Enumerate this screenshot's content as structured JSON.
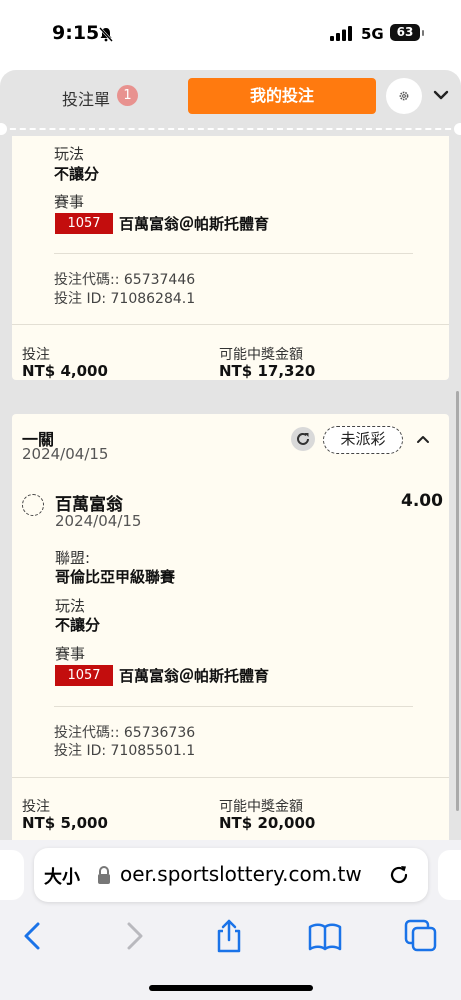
{
  "status_bar": {
    "time": "9:15",
    "network": "5G",
    "battery": "63"
  },
  "header": {
    "slip_tab": "投注單",
    "slip_count": "1",
    "my_bets_tab": "我的投注"
  },
  "bet_top": {
    "play_label": "玩法",
    "play_value": "不讓分",
    "event_label": "賽事",
    "event_number": "1057",
    "event_name": "百萬富翁＠帕斯托體育",
    "code_line": "投注代碼:: 65737446",
    "id_line": "投注 ID: 71086284.1",
    "stake_label": "投注",
    "stake_value": "NT$ 4,000",
    "payout_label": "可能中獎金額",
    "payout_value": "NT$ 17,320"
  },
  "bet_second": {
    "type": "一關",
    "date": "2024/04/15",
    "status": "未派彩",
    "selection": "百萬富翁",
    "selection_date": "2024/04/15",
    "odds": "4.00",
    "league_label": "聯盟:",
    "league_value": "哥倫比亞甲級聯賽",
    "play_label": "玩法",
    "play_value": "不讓分",
    "event_label": "賽事",
    "event_number": "1057",
    "event_name": "百萬富翁＠帕斯托體育",
    "code_line": "投注代碼:: 65736736",
    "id_line": "投注 ID: 71085501.1",
    "stake_label": "投注",
    "stake_value": "NT$ 5,000",
    "payout_label": "可能中獎金額",
    "payout_value": "NT$ 20,000"
  },
  "browser": {
    "aa_label": "大小",
    "url": "oer.sportslottery.com.tw"
  },
  "colors": {
    "accent": "#ff7a0f",
    "event_badge": "#c30d0d",
    "card_bg": "#fffcf2"
  }
}
